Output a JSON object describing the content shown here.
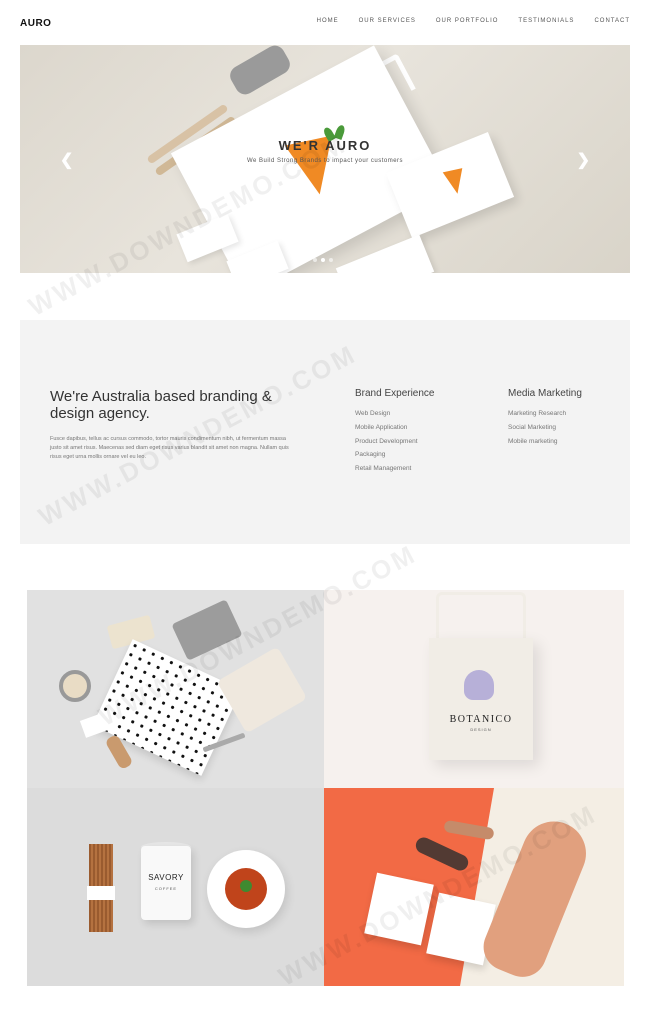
{
  "header": {
    "logo": "AURO",
    "nav": [
      "HOME",
      "OUR SERVICES",
      "OUR PORTFOLIO",
      "TESTIMONIALS",
      "CONTACT"
    ]
  },
  "hero": {
    "title": "WE'R AURO",
    "subtitle": "We Build Strong Brands to impact your customers",
    "prev_icon": "chevron-left-icon",
    "next_icon": "chevron-right-icon",
    "prev_glyph": "❮",
    "next_glyph": "❯",
    "slides": 3,
    "active_slide": 1
  },
  "about": {
    "heading": "We're Australia based branding & design agency.",
    "text": "Fusce dapibus, tellus ac cursus commodo, tortor mauris condimentum nibh, ut fermentum massa justo sit amet risus. Maecenas sed diam eget risus varius blandit sit amet non magna. Nullam quis risus eget urna mollis ornare vel eu leo.",
    "columns": [
      {
        "title": "Brand Experience",
        "items": [
          "Web Design",
          "Mobile Application",
          "Product Development",
          "Packaging",
          "Retail Management"
        ]
      },
      {
        "title": "Media Marketing",
        "items": [
          "Marketing Research",
          "Social Marketing",
          "Mobile marketing"
        ]
      }
    ]
  },
  "portfolio": {
    "tile2_brand": "BOTANICO",
    "tile2_brand_sub": "DESIGN",
    "tile3_brand": "SAVORY",
    "tile3_brand_sub": "COFFEE"
  },
  "watermark": "WWW.DOWNDEMO.COM",
  "colors": {
    "accent_orange": "#f08a24",
    "leaf_green": "#4a9a3a",
    "about_bg": "#f3f3f3",
    "tile_orange": "#f26a45"
  }
}
